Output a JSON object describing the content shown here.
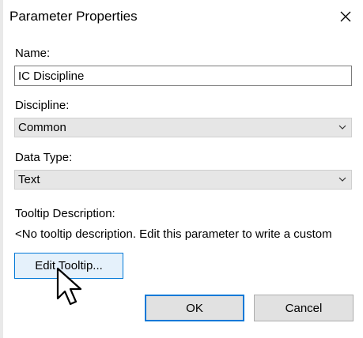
{
  "dialog": {
    "title": "Parameter Properties",
    "close_icon": "close-icon"
  },
  "name": {
    "label": "Name:",
    "value": "IC Discipline"
  },
  "discipline": {
    "label": "Discipline:",
    "selected": "Common"
  },
  "data_type": {
    "label": "Data Type:",
    "selected": "Text"
  },
  "tooltip": {
    "label": "Tooltip Description:",
    "text": "<No tooltip description. Edit this parameter to write a custom",
    "edit_button": "Edit Tooltip..."
  },
  "footer": {
    "ok_label": "OK",
    "cancel_label": "Cancel"
  },
  "colors": {
    "accent": "#0078d7",
    "dropdown_bg": "#e6e6e6",
    "button_bg": "#e1e1e1",
    "hover_bg": "#e5f1fb"
  },
  "icons": {
    "dropdown": "chevron-down-icon",
    "cursor": "mouse-pointer-icon"
  }
}
